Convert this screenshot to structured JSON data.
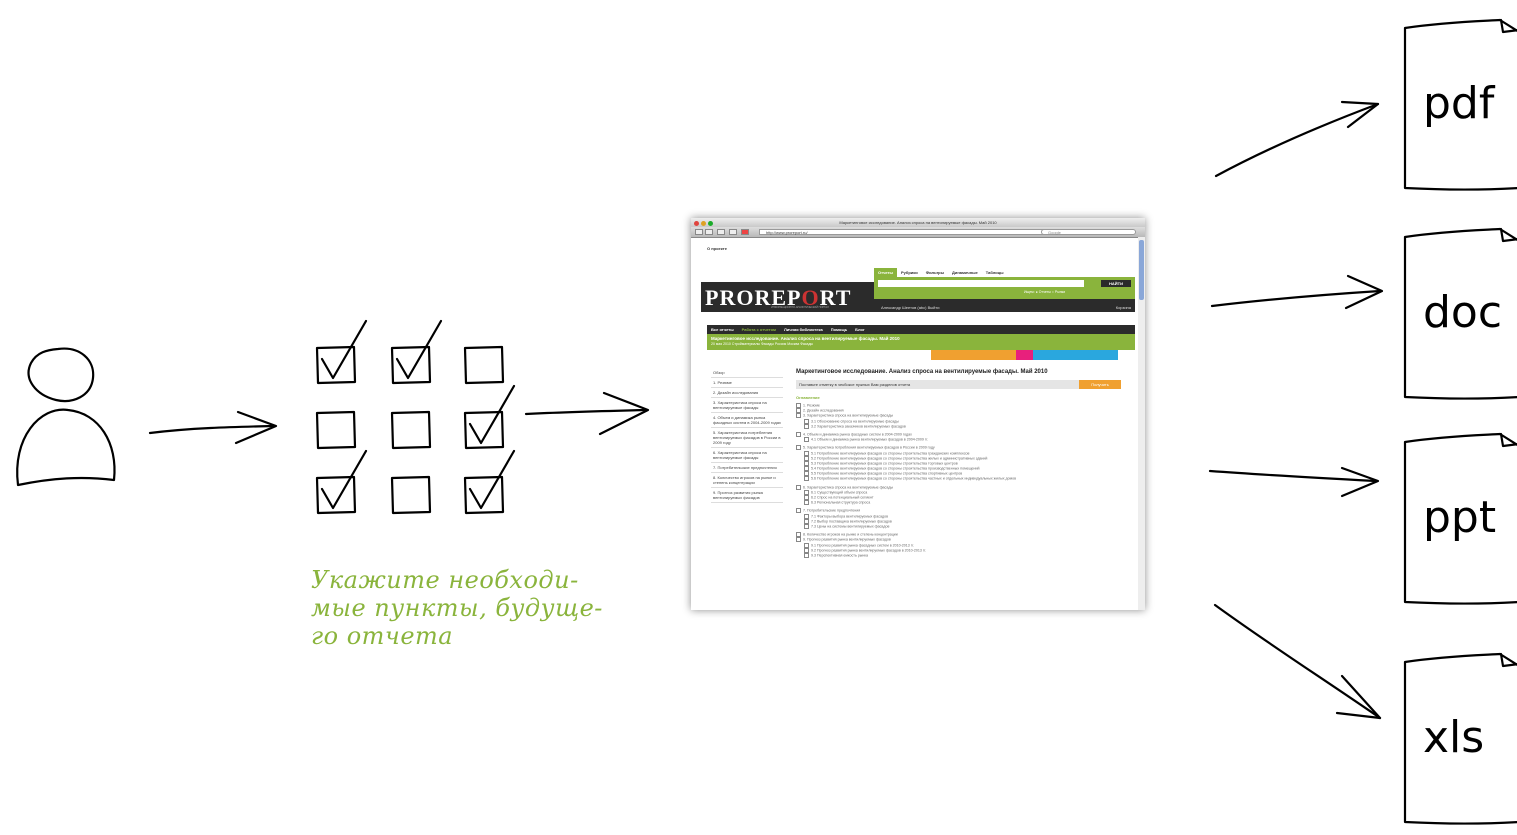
{
  "caption": {
    "line1": "Укажите необходи-",
    "line2": "мые пункты, будуще-",
    "line3": "го отчета"
  },
  "checkbox_grid": [
    [
      true,
      true,
      false
    ],
    [
      false,
      false,
      true
    ],
    [
      true,
      false,
      true
    ]
  ],
  "browser": {
    "window_title": "Маркетинговое исследование. Анализ спроса на вентилируемые фасады. Май 2010",
    "url": "http://www.proreport.ru/",
    "search_placeholder": "Google",
    "topline": "О проекте",
    "tabs": [
      "Отчеты",
      "Рубрики",
      "Фильтры",
      "Динамичные",
      "Таблицы"
    ],
    "search_button": "НАЙТИ",
    "search_options": "Ищем: ● Отчеты ○ Рынки",
    "logo_main": "PROREP",
    "logo_o": "O",
    "logo_end": "RT",
    "logo_sub": "ИНФОРМАЦИОННО-АНАЛИТИЧЕСКИЙ ПОРТАЛ",
    "user_line": "Александр Шеетов (abc)   Выйти",
    "cart": "Корзина",
    "menu": [
      "Все отчеты",
      "Работа с отчетом",
      "Личная библиотека",
      "Помощь",
      "Блог"
    ],
    "report_title": "Маркетинговое исследование. Анализ спроса на вентилируемые фасады. Май 2010",
    "report_meta": "20 мая 2010   Стройматериалы   Фасады   Россия   Москва   Фасады",
    "sidebar": [
      "Обзор",
      "1. Резюме",
      "2. Дизайн исследования",
      "3. Характеристика спроса на вентилируемые фасады",
      "4. Объем и динамика рынка фасадных систем в 2004-2009 годах",
      "5. Характеристика потребления вентилируемых фасадов в России в 2009 году",
      "6. Характеристика спроса на вентилируемые фасады",
      "7. Потребительские предпочтения",
      "8. Количество игроков на рынке и степень концентрации",
      "9. Прогноз развития рынка вентилируемых фасадов"
    ],
    "main_title": "Маркетинговое исследование. Анализ спроса на вентилируемые фасады. Май 2010",
    "instruction": "Поставьте отметку в чекбоксе нужных Вам разделов отчета",
    "order_button": "Получить",
    "contents_label": "Оглавление",
    "toc": [
      {
        "level": 1,
        "text": "1. Резюме"
      },
      {
        "level": 1,
        "text": "2. Дизайн исследования"
      },
      {
        "level": 1,
        "text": "3. Характеристика спроса на вентилируемые фасады"
      },
      {
        "level": 2,
        "text": "3.1 Обоснование спроса на вентилируемые фасады"
      },
      {
        "level": 2,
        "text": "3.2 Характеристика заказчиков вентилируемых фасадов"
      },
      {
        "level": 0,
        "text": ""
      },
      {
        "level": 1,
        "text": "4. Объем и динамика рынка фасадных систем в 2004-2009 годах"
      },
      {
        "level": 2,
        "text": "4.1 Объем и динамика рынка вентилируемых фасадов в 2004-2009 гг."
      },
      {
        "level": 0,
        "text": ""
      },
      {
        "level": 1,
        "text": "5. Характеристика потребления вентилируемых фасадов в России в 2009 году"
      },
      {
        "level": 2,
        "text": "5.1 Потребление вентилируемых фасадов со стороны строительства гражданских комплексов"
      },
      {
        "level": 2,
        "text": "5.2 Потребление вентилируемых фасадов со стороны строительства жилых и административных зданий"
      },
      {
        "level": 2,
        "text": "5.3 Потребление вентилируемых фасадов со стороны строительства торговых центров"
      },
      {
        "level": 2,
        "text": "5.4 Потребление вентилируемых фасадов со стороны строительства производственных помещений"
      },
      {
        "level": 2,
        "text": "5.5 Потребление вентилируемых фасадов со стороны строительства спортивных центров"
      },
      {
        "level": 2,
        "text": "5.6 Потребление вентилируемых фасадов со стороны строительства частных и отдельных индивидуальных жилых домов"
      },
      {
        "level": 0,
        "text": ""
      },
      {
        "level": 1,
        "text": "6. Характеристика спроса на вентилируемые фасады"
      },
      {
        "level": 2,
        "text": "6.1 Существующий объем спроса"
      },
      {
        "level": 2,
        "text": "6.2 Спрос на потенциальный сегмент"
      },
      {
        "level": 2,
        "text": "6.3 Региональная структура спроса"
      },
      {
        "level": 0,
        "text": ""
      },
      {
        "level": 1,
        "text": "7. Потребительские предпочтения"
      },
      {
        "level": 2,
        "text": "7.1 Факторы выбора вентилируемых фасадов"
      },
      {
        "level": 2,
        "text": "7.2 Выбор поставщика вентилируемых фасадов"
      },
      {
        "level": 2,
        "text": "7.3 Цены на системы вентилируемых фасадов"
      },
      {
        "level": 0,
        "text": ""
      },
      {
        "level": 1,
        "text": "8. Количество игроков на рынке и степень концентрации"
      },
      {
        "level": 1,
        "text": "9. Прогноз развития рынка вентилируемых фасадов"
      },
      {
        "level": 2,
        "text": "9.1 Прогноз развития рынка фасадных систем в 2010-2013 гг."
      },
      {
        "level": 2,
        "text": "9.2 Прогноз развития рынка вентилируемых фасадов в 2010-2013 гг."
      },
      {
        "level": 2,
        "text": "9.3 Перспективная емкость рынка"
      }
    ]
  },
  "formats": [
    "pdf",
    "doc",
    "ppt",
    "xls"
  ],
  "colors": {
    "accent": "#8ab43c",
    "ink": "#000000"
  },
  "icon_names": [
    "user-icon",
    "arrow-icon",
    "checkbox-icon",
    "checkmark-icon",
    "document-icon"
  ]
}
